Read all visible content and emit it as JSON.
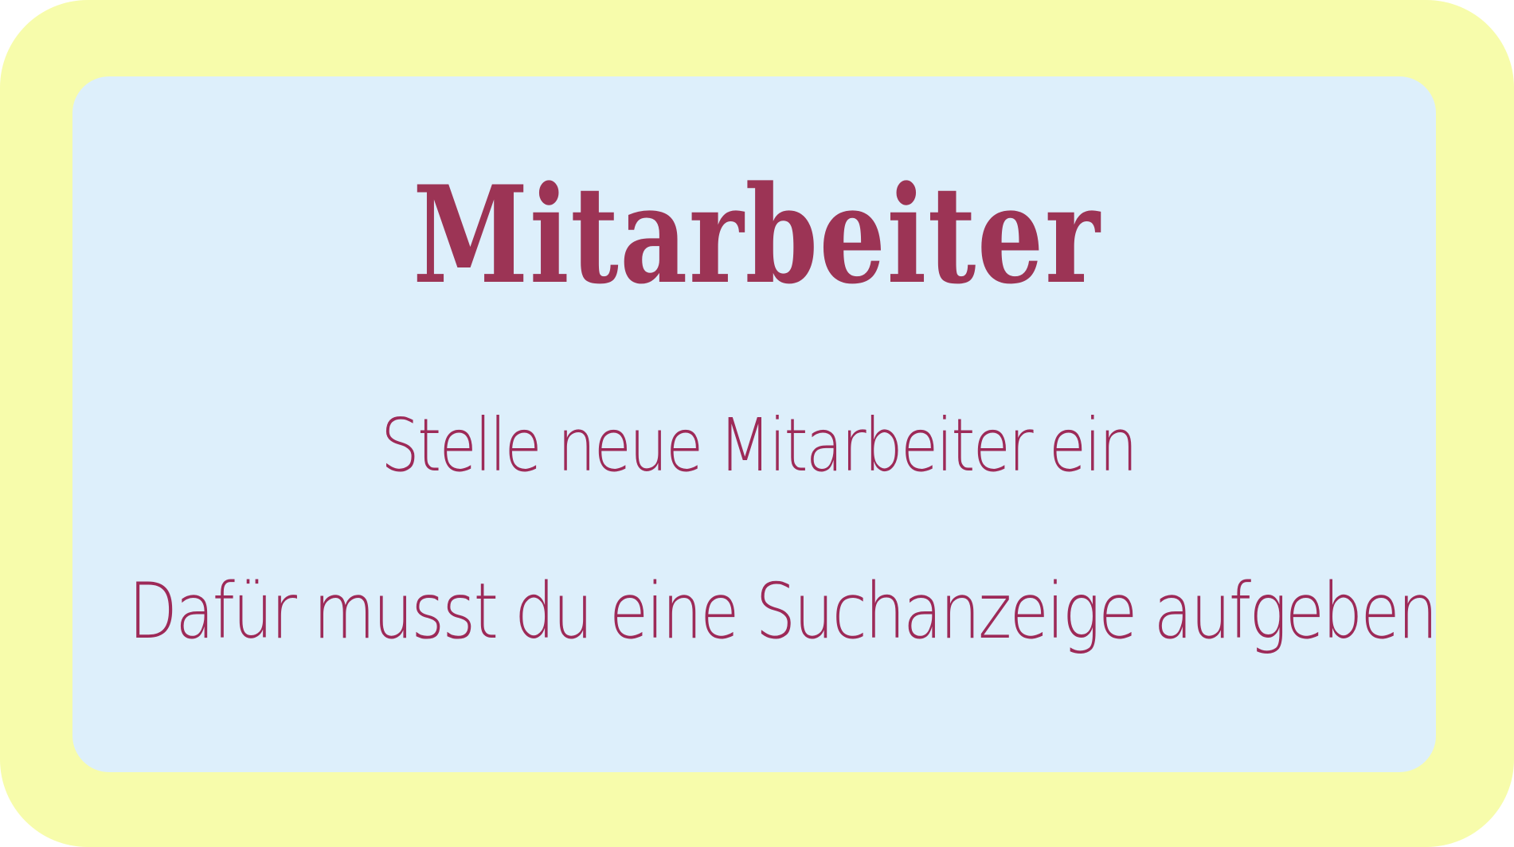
{
  "card": {
    "outer_color": "#f7fcab",
    "inner_color": "#ddeffb",
    "text_color": "#9d2a58",
    "title_color": "#9c3455"
  },
  "title": "Mitarbeiter",
  "lines": [
    "Stelle neue Mitarbeiter ein",
    "Dafür musst du eine Suchanzeige aufgeben"
  ]
}
